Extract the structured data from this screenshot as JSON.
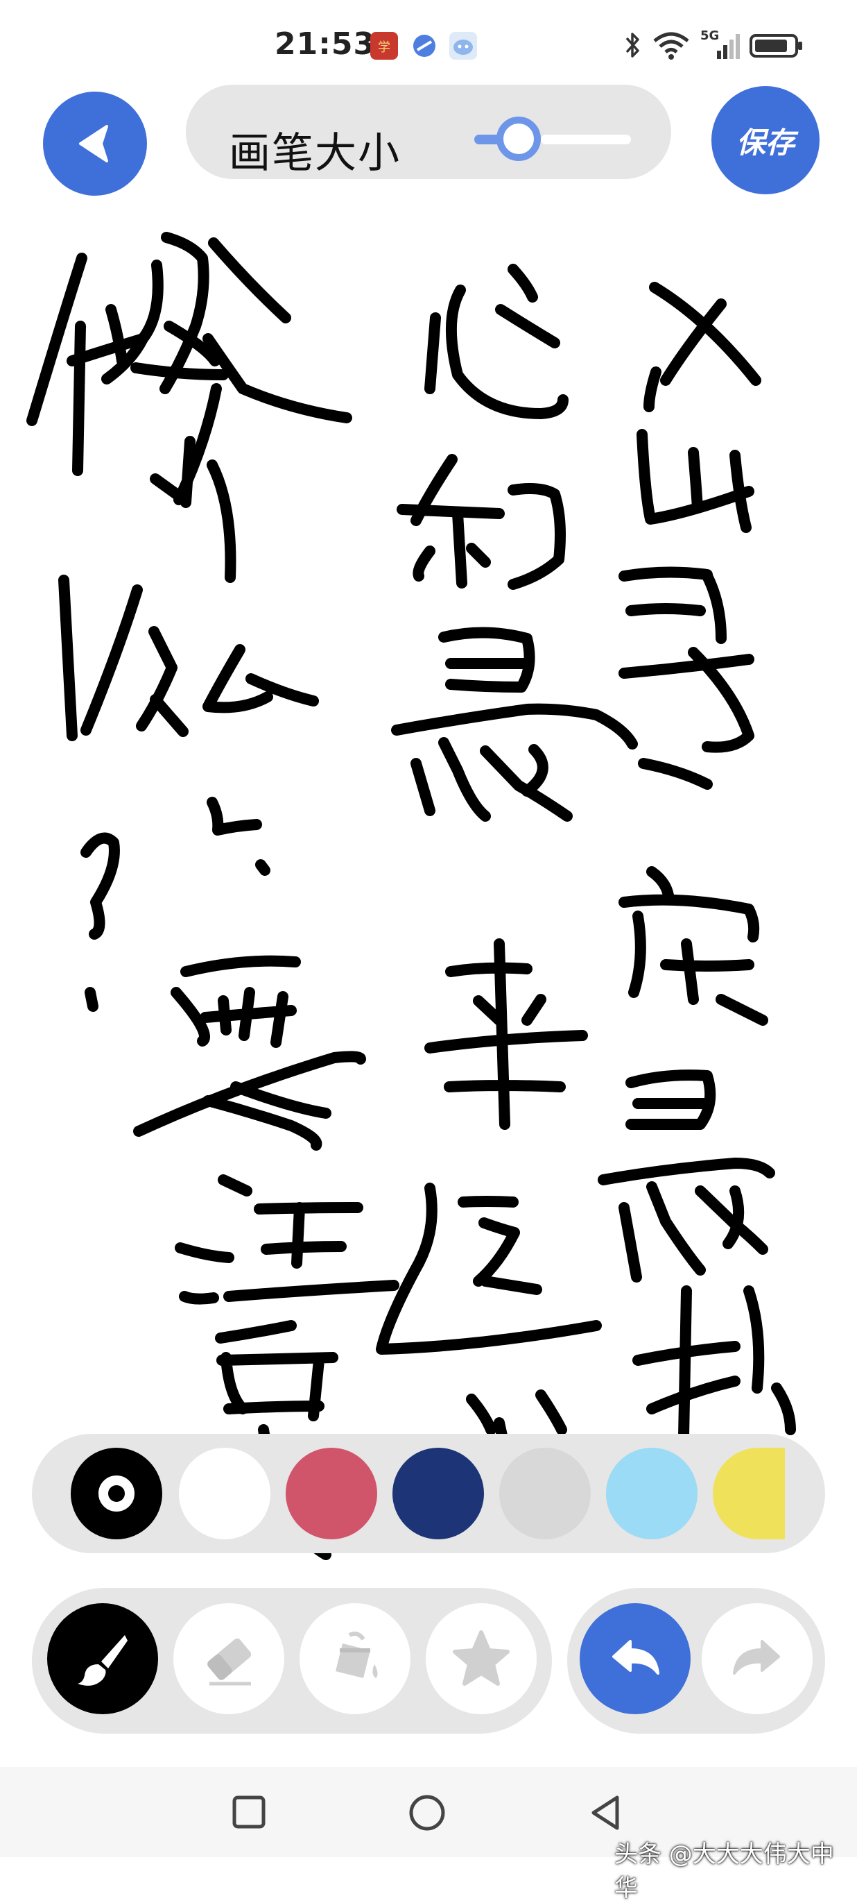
{
  "status_bar": {
    "time": "21:53",
    "network": "5G",
    "apps": [
      "xuexi-app-icon",
      "browser-app-icon",
      "assistant-app-icon"
    ]
  },
  "toolbar": {
    "back_icon": "back-arrow-icon",
    "brush_size_label": "画笔大小",
    "brush_size_value": 0.2,
    "save_label": "保存",
    "accent_color": "#3f6fd9"
  },
  "canvas": {
    "ink_color": "#000000",
    "content": "handwritten"
  },
  "palette": {
    "colors": [
      "#000000",
      "#ffffff",
      "#d1556a",
      "#1d3577",
      "#d8d8d8",
      "#9bdbf5",
      "#f0e15a"
    ],
    "selected_index": 0
  },
  "tools": {
    "items": [
      "brush-icon",
      "eraser-icon",
      "fill-bucket-icon",
      "sticker-star-icon"
    ],
    "selected": "brush-icon",
    "undo_icon": "undo-icon",
    "redo_icon": "redo-icon"
  },
  "navbar": {
    "items": [
      "recent-apps-icon",
      "home-icon",
      "back-icon"
    ],
    "watermark": "头条 @大大大伟大中华"
  }
}
